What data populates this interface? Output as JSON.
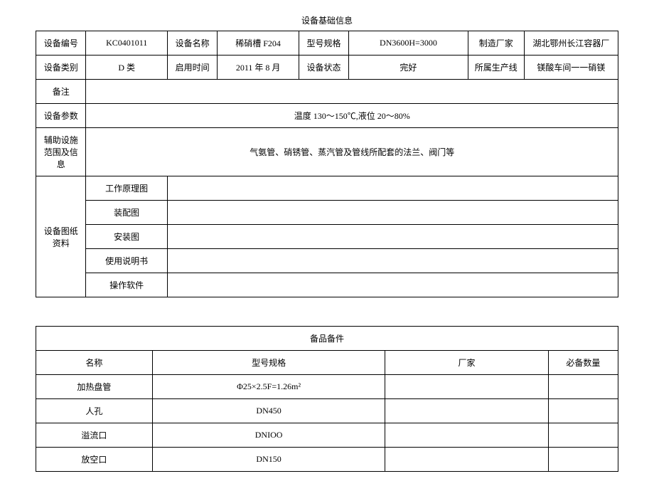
{
  "table1": {
    "title": "设备基础信息",
    "rows": {
      "r1": {
        "equip_no_label": "设备编号",
        "equip_no_value": "KC0401011",
        "equip_name_label": "设备名称",
        "equip_name_value": "稀硝槽 F204",
        "model_spec_label": "型号规格",
        "model_spec_value": "DN3600H=3000",
        "mfr_label": "制造厂家",
        "mfr_value": "湖北鄂州长江容器厂"
      },
      "r2": {
        "equip_cat_label": "设备类别",
        "equip_cat_value": "D 类",
        "start_time_label": "启用时间",
        "start_time_value": "2011 年 8 月",
        "equip_status_label": "设备状态",
        "equip_status_value": "完好",
        "line_label": "所属生产线",
        "line_value": "镁酸车间一一硝镁"
      },
      "r3": {
        "remark_label": "备注",
        "remark_value": ""
      },
      "r4": {
        "param_label": "设备参数",
        "param_value": "温度 130～150℃,液位 20～80%"
      },
      "r5": {
        "aux_label": "辅助设施范围及信息",
        "aux_value": "气氨管、硝锈管、蒸汽管及管线所配套的法兰、阀门等"
      },
      "drawings": {
        "group_label": "设备图纸资料",
        "items": {
          "i1": "工作原理图",
          "i2": "装配图",
          "i3": "安装图",
          "i4": "使用说明书",
          "i5": "操作软件"
        }
      }
    }
  },
  "table2": {
    "title": "备品备件",
    "headers": {
      "name": "名称",
      "spec": "型号规格",
      "mfr": "厂家",
      "qty": "必备数量"
    },
    "rows": {
      "r1": {
        "name": "加热盘管",
        "spec": "Φ25×2.5F=1.26m²",
        "mfr": "",
        "qty": ""
      },
      "r2": {
        "name": "人孔",
        "spec": "DN450",
        "mfr": "",
        "qty": ""
      },
      "r3": {
        "name": "溢流口",
        "spec": "DNIOO",
        "mfr": "",
        "qty": ""
      },
      "r4": {
        "name": "放空口",
        "spec": "DN150",
        "mfr": "",
        "qty": ""
      }
    }
  }
}
